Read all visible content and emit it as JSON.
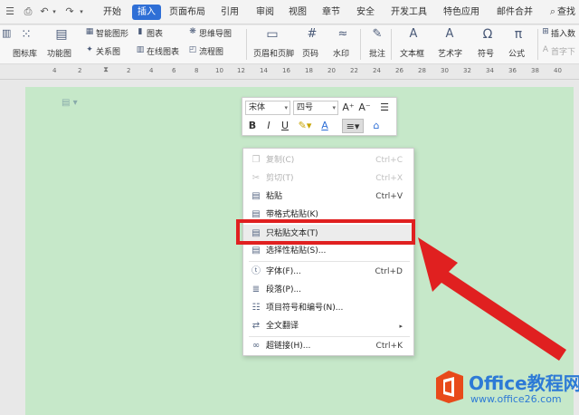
{
  "menu_tabs": [
    "开始",
    "插入",
    "页面布局",
    "引用",
    "审阅",
    "视图",
    "章节",
    "安全",
    "开发工具",
    "特色应用",
    "邮件合并"
  ],
  "active_tab": "插入",
  "search_label": "查找",
  "ribbon": {
    "picture_lib": "图标库",
    "function_chart": "功能图",
    "smart_graphic": "智能图形",
    "chart": "图表",
    "mind_map": "思维导图",
    "relation_chart": "关系图",
    "online_chart": "在线图表",
    "flowchart": "流程图",
    "header_footer": "页眉和页脚",
    "page_number": "页码",
    "watermark": "水印",
    "comment": "批注",
    "textbox": "文本框",
    "art_text": "艺术字",
    "symbol": "符号",
    "formula": "公式",
    "insert_number": "插入数",
    "first_drop": "首字下"
  },
  "ruler_numbers": [
    "4",
    "2",
    "2",
    "4",
    "6",
    "8",
    "10",
    "12",
    "14",
    "16",
    "18",
    "20",
    "22",
    "24",
    "26",
    "28",
    "30",
    "32",
    "34",
    "36",
    "38",
    "40"
  ],
  "mini_toolbar": {
    "font": "宋体",
    "size": "四号",
    "grow": "A⁺",
    "shrink": "A⁻",
    "bold": "B",
    "italic": "I",
    "underline": "U",
    "font_color": "A"
  },
  "context_menu": [
    {
      "label": "复制(C)",
      "shortcut": "Ctrl+C",
      "icon": "copy-icon",
      "disabled": true
    },
    {
      "label": "剪切(T)",
      "shortcut": "Ctrl+X",
      "icon": "scissors-icon",
      "disabled": true
    },
    {
      "label": "粘贴",
      "shortcut": "Ctrl+V",
      "icon": "paste-icon",
      "disabled": false
    },
    {
      "label": "带格式粘贴(K)",
      "shortcut": "",
      "icon": "paste-format-icon",
      "disabled": false
    },
    {
      "label": "只粘贴文本(T)",
      "shortcut": "",
      "icon": "paste-text-icon",
      "disabled": false,
      "highlighted": true
    },
    {
      "label": "选择性粘贴(S)...",
      "shortcut": "",
      "icon": "paste-special-icon",
      "disabled": false
    },
    {
      "label": "字体(F)...",
      "shortcut": "Ctrl+D",
      "icon": "font-icon",
      "disabled": false
    },
    {
      "label": "段落(P)...",
      "shortcut": "",
      "icon": "paragraph-icon",
      "disabled": false
    },
    {
      "label": "项目符号和编号(N)...",
      "shortcut": "",
      "icon": "list-icon",
      "disabled": false
    },
    {
      "label": "全文翻译",
      "shortcut": "",
      "icon": "translate-icon",
      "disabled": false,
      "submenu": true
    },
    {
      "label": "超链接(H)...",
      "shortcut": "Ctrl+K",
      "icon": "link-icon",
      "disabled": false
    }
  ],
  "watermark_logo": {
    "title": "Office教程网",
    "url": "www.office26.com"
  },
  "colors": {
    "accent": "#2f6fd6",
    "page": "#c6e8c9",
    "highlight": "#e02020"
  }
}
